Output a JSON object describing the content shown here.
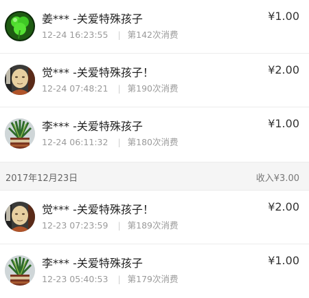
{
  "groups": [
    {
      "items": [
        {
          "avatar": "green-clover-avatar",
          "title": "姜*** -关爱特殊孩子",
          "time": "12-24 16:23:55",
          "count": "第142次消费",
          "amount": "¥1.00"
        },
        {
          "avatar": "monk-avatar",
          "title": "觉*** -关爱特殊孩子！",
          "time": "12-24 07:48:21",
          "count": "第190次消费",
          "amount": "¥2.00"
        },
        {
          "avatar": "plant-avatar",
          "title": "李*** -关爱特殊孩子",
          "time": "12-24 06:11:32",
          "count": "第180次消费",
          "amount": "¥1.00"
        }
      ]
    },
    {
      "date": "2017年12月23日",
      "income": "收入¥3.00",
      "items": [
        {
          "avatar": "monk-avatar",
          "title": "觉*** -关爱特殊孩子！",
          "time": "12-23 07:23:59",
          "count": "第189次消费",
          "amount": "¥2.00"
        },
        {
          "avatar": "plant-avatar",
          "title": "李*** -关爱特殊孩子",
          "time": "12-23 05:40:53",
          "count": "第179次消费",
          "amount": "¥1.00"
        }
      ]
    }
  ],
  "separator": "|"
}
